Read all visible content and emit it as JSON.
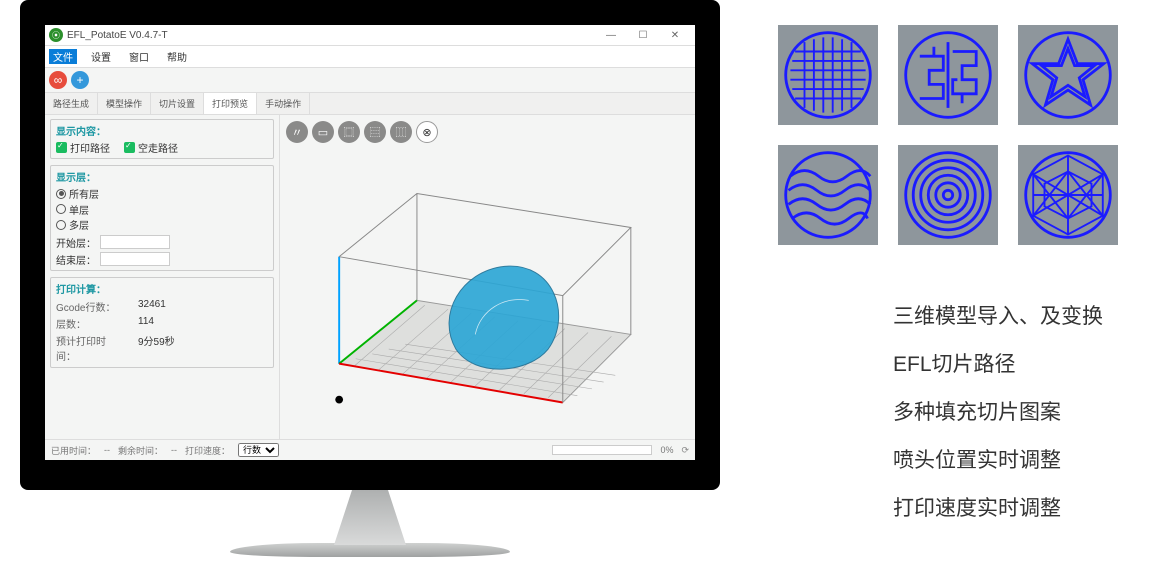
{
  "window": {
    "title": "EFL_PotatoE V0.4.7-T",
    "controls": {
      "min": "—",
      "max": "☐",
      "close": "✕"
    }
  },
  "menu": {
    "file": "文件",
    "settings": "设置",
    "window": "窗口",
    "help": "帮助"
  },
  "toolbar": {
    "cut_icon": "∞",
    "add_icon": "+"
  },
  "tabs": {
    "path_gen": "路径生成",
    "model_ops": "模型操作",
    "slice_set": "切片设置",
    "print_prev": "打印预览",
    "manual_ops": "手动操作"
  },
  "panel": {
    "disp_content_title": "显示内容：",
    "chk_print_path": "打印路径",
    "chk_travel_path": "空走路径",
    "disp_layer_title": "显示层：",
    "rad_all": "所有层",
    "rad_single": "单层",
    "rad_multi": "多层",
    "start_layer_label": "开始层：",
    "end_layer_label": "结束层：",
    "calc_title": "打印计算：",
    "gcode_lines_label": "Gcode行数：",
    "gcode_lines_val": "32461",
    "layers_label": "层数：",
    "layers_val": "114",
    "est_time_label": "预计打印时间：",
    "est_time_val": "9分59秒"
  },
  "viewport_toolbar": {
    "b1": "〃",
    "b2": "▭",
    "b3": "⿴",
    "b4": "⿳",
    "b5": "⿲",
    "b6": "⊗"
  },
  "status": {
    "used_time_label": "已用时间：",
    "used_time_val": "--",
    "remain_label": "剩余时间：",
    "remain_val": "--",
    "speed_label": "打印速度：",
    "dropdown_label": "行数",
    "progress_val": "0%"
  },
  "patterns": {
    "p1": "grid",
    "p2": "maze",
    "p3": "star",
    "p4": "waves",
    "p5": "concentric",
    "p6": "triangles"
  },
  "features": {
    "f1": "三维模型导入、及变换",
    "f2": "EFL切片路径",
    "f3": "多种填充切片图案",
    "f4": "喷头位置实时调整",
    "f5": "打印速度实时调整"
  }
}
